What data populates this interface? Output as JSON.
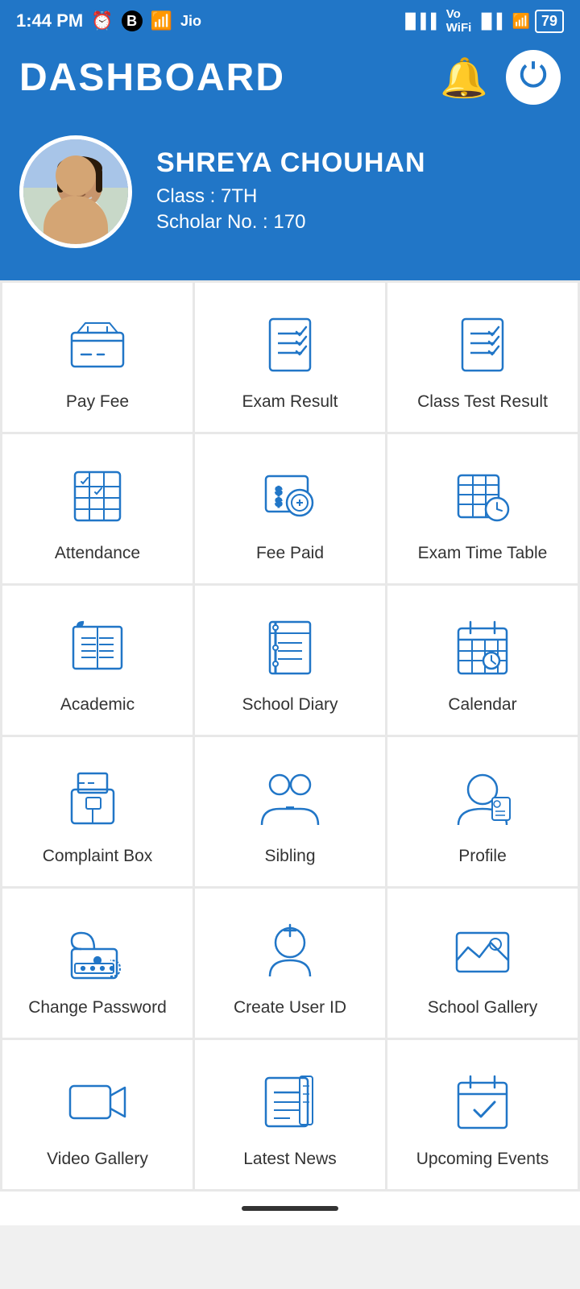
{
  "statusBar": {
    "time": "1:44 PM",
    "battery": "79"
  },
  "header": {
    "title": "DASHBOARD",
    "bellLabel": "notifications",
    "powerLabel": "power"
  },
  "profile": {
    "name": "SHREYA  CHOUHAN",
    "classLabel": "Class : 7TH",
    "scholarLabel": "Scholar No. : 170"
  },
  "grid": {
    "items": [
      {
        "id": "pay-fee",
        "label": "Pay Fee"
      },
      {
        "id": "exam-result",
        "label": "Exam Result"
      },
      {
        "id": "class-test",
        "label": "Class Test Result"
      },
      {
        "id": "attendance",
        "label": "Attendance"
      },
      {
        "id": "fee-paid",
        "label": "Fee Paid"
      },
      {
        "id": "exam-timetable",
        "label": "Exam Time Table"
      },
      {
        "id": "academic",
        "label": "Academic"
      },
      {
        "id": "school-diary",
        "label": "School Diary"
      },
      {
        "id": "calendar",
        "label": "Calendar"
      },
      {
        "id": "complaint-box",
        "label": "Complaint Box"
      },
      {
        "id": "sibling",
        "label": "Sibling"
      },
      {
        "id": "profile",
        "label": "Profile"
      },
      {
        "id": "change-password",
        "label": "Change Password"
      },
      {
        "id": "create-user-id",
        "label": "Create User ID"
      },
      {
        "id": "school-gallery",
        "label": "School Gallery"
      },
      {
        "id": "video-gallery",
        "label": "Video Gallery"
      },
      {
        "id": "latest-news",
        "label": "Latest News"
      },
      {
        "id": "upcoming-events",
        "label": "Upcoming Events"
      }
    ]
  }
}
